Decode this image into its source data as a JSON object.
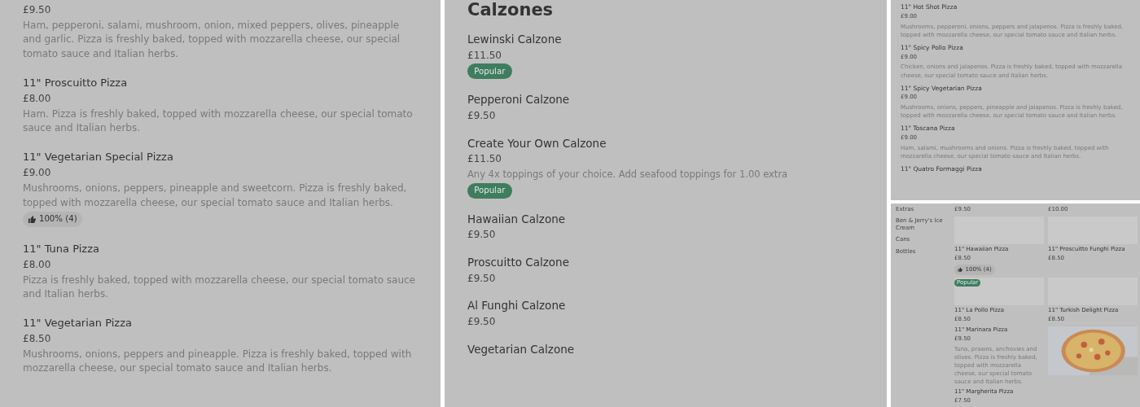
{
  "left_menu": {
    "items": [
      {
        "price": "£9.50",
        "description": "Ham, pepperoni, salami, mushroom, onion, mixed peppers, olives, pineapple and garlic. Pizza is freshly baked, topped with mozzarella cheese, our special tomato sauce and Italian herbs."
      },
      {
        "name": "11\" Proscuitto Pizza",
        "price": "£8.00",
        "description": "Ham. Pizza is freshly baked, topped with mozzarella cheese, our special tomato sauce and Italian herbs."
      },
      {
        "name": "11\" Vegetarian Special Pizza",
        "price": "£9.00",
        "description": "Mushrooms, onions, peppers, pineapple and sweetcorn. Pizza is freshly baked, topped with mozzarella cheese, our special tomato sauce and Italian herbs.",
        "rating": "100% (4)"
      },
      {
        "name": "11\" Tuna Pizza",
        "price": "£8.00",
        "description": "Pizza is freshly baked, topped with mozzarella cheese, our special tomato sauce and Italian herbs."
      },
      {
        "name": "11\" Vegetarian Pizza",
        "price": "£8.50",
        "description": "Mushrooms, onions, peppers and pineapple. Pizza is freshly baked, topped with mozzarella cheese, our special tomato sauce and Italian herbs."
      }
    ]
  },
  "calzones": {
    "heading": "Calzones",
    "items": [
      {
        "name": "Lewinski Calzone",
        "price": "£11.50",
        "badge": "Popular"
      },
      {
        "name": "Pepperoni Calzone",
        "price": "£9.50"
      },
      {
        "name": "Create Your Own Calzone",
        "price": "£11.50",
        "description": "Any 4x toppings of your choice. Add seafood toppings for 1.00 extra",
        "badge": "Popular"
      },
      {
        "name": "Hawaiian Calzone",
        "price": "£9.50"
      },
      {
        "name": "Proscuitto Calzone",
        "price": "£9.50"
      },
      {
        "name": "Al Funghi Calzone",
        "price": "£9.50"
      },
      {
        "name": "Vegetarian Calzone"
      }
    ]
  },
  "right_top": {
    "items": [
      {
        "name": "11\" Hot Shot Pizza",
        "price": "£9.00",
        "description": "Mushrooms, pepperoni, onions, peppers and jalapenos. Pizza is freshly baked, topped with mozzarella cheese, our special tomato sauce and Italian herbs."
      },
      {
        "name": "11\" Spicy Pollo Pizza",
        "price": "£9.00",
        "description": "Chicken, onions and jalapenos. Pizza is freshly baked, topped with mozzarella cheese, our special tomato sauce and Italian herbs."
      },
      {
        "name": "11\" Spicy Vegetarian Pizza",
        "price": "£9.00",
        "description": "Mushrooms, onions, peppers, pineapple and jalapenos. Pizza is freshly baked, topped with mozzarella cheese, our special tomato sauce and Italian herbs."
      },
      {
        "name": "11\" Toscana Pizza",
        "price": "£9.00",
        "description": "Ham, salami, mushrooms and onions. Pizza is freshly baked, topped with mozzarella cheese, our special tomato sauce and Italian herbs."
      },
      {
        "name": "11\" Quatro Formaggi Pizza"
      }
    ]
  },
  "right_bottom": {
    "sidebar": {
      "items": [
        "Extras",
        "Ben & Jerry's Ice Cream",
        "Cans",
        "Bottles"
      ]
    },
    "grid": [
      {
        "kind": "price",
        "price": "£9.50"
      },
      {
        "kind": "price",
        "price": "£10.00"
      },
      {
        "kind": "tile",
        "name": "11\" Hawaiian Pizza",
        "price": "£8.50",
        "rating": "100% (4)"
      },
      {
        "kind": "tile",
        "name": "11\" Proscuitto Funghi Pizza",
        "price": "£8.50"
      },
      {
        "kind": "tile",
        "name": "11\" La Pollo Pizza",
        "price": "£8.50",
        "badge": "Popular"
      },
      {
        "kind": "tile",
        "name": "11\" Turkish Delight Pizza",
        "price": "£8.50"
      },
      {
        "kind": "text",
        "name": "11\" Marinara Pizza",
        "price": "£9.50",
        "description": "Tuna, prawns, anchovies and olives. Pizza is freshly baked, topped with mozzarella cheese, our special tomato sauce and Italian herbs."
      },
      {
        "kind": "picture"
      },
      {
        "kind": "text",
        "name": "11\" Margherita Pizza",
        "price": "£7.50"
      }
    ]
  }
}
